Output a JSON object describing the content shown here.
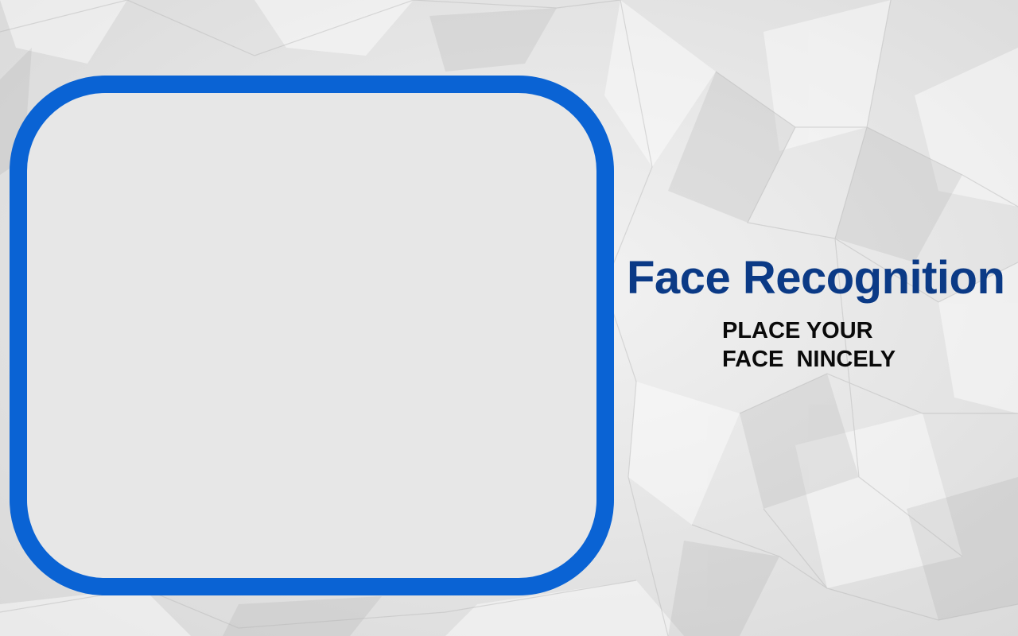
{
  "app": {
    "title": "Face Recognition",
    "instruction_lines": [
      "PLACE YOUR",
      "FACE  NINCELY"
    ]
  },
  "camera": {
    "state": "idle"
  },
  "colors": {
    "frame_border": "#0a63d4",
    "frame_fill": "#e7e7e7",
    "title": "#0b3a86",
    "instruction": "#0a0a0a",
    "background": "#e6e6e6"
  },
  "icons": {
    "background": "crumpled-paper-texture"
  }
}
